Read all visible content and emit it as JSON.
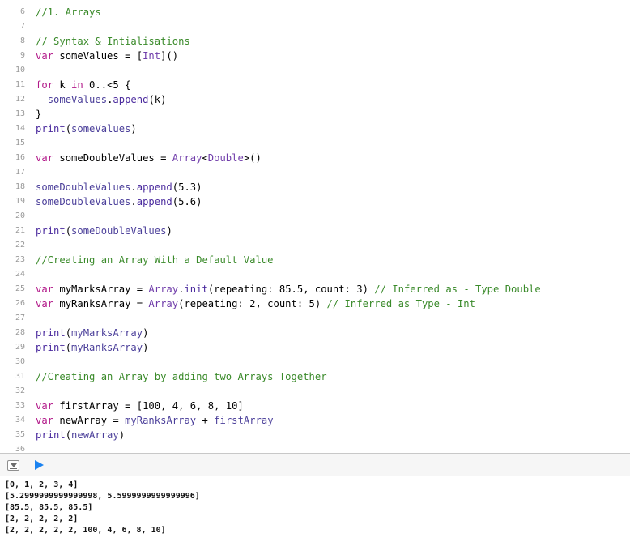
{
  "editor": {
    "lines": [
      {
        "num": "6",
        "tokens": [
          {
            "t": "//1. Arrays",
            "c": "cm"
          }
        ]
      },
      {
        "num": "7",
        "tokens": []
      },
      {
        "num": "8",
        "tokens": [
          {
            "t": "// Syntax & Intialisations",
            "c": "cm"
          }
        ]
      },
      {
        "num": "9",
        "tokens": [
          {
            "t": "var",
            "c": "kw"
          },
          {
            "t": " someValues = [",
            "c": "pl"
          },
          {
            "t": "Int",
            "c": "ty"
          },
          {
            "t": "]()",
            "c": "pl"
          }
        ]
      },
      {
        "num": "10",
        "tokens": []
      },
      {
        "num": "11",
        "tokens": [
          {
            "t": "for",
            "c": "kw"
          },
          {
            "t": " k ",
            "c": "pl"
          },
          {
            "t": "in",
            "c": "kw"
          },
          {
            "t": " 0..<5 {",
            "c": "pl"
          }
        ]
      },
      {
        "num": "12",
        "tokens": [
          {
            "t": "  ",
            "c": "pl"
          },
          {
            "t": "someValues",
            "c": "id"
          },
          {
            "t": ".",
            "c": "pl"
          },
          {
            "t": "append",
            "c": "fn"
          },
          {
            "t": "(k)",
            "c": "pl"
          }
        ]
      },
      {
        "num": "13",
        "tokens": [
          {
            "t": "}",
            "c": "pl"
          }
        ]
      },
      {
        "num": "14",
        "tokens": [
          {
            "t": "print",
            "c": "fn"
          },
          {
            "t": "(",
            "c": "pl"
          },
          {
            "t": "someValues",
            "c": "id"
          },
          {
            "t": ")",
            "c": "pl"
          }
        ]
      },
      {
        "num": "15",
        "tokens": []
      },
      {
        "num": "16",
        "tokens": [
          {
            "t": "var",
            "c": "kw"
          },
          {
            "t": " someDoubleValues = ",
            "c": "pl"
          },
          {
            "t": "Array",
            "c": "ty"
          },
          {
            "t": "<",
            "c": "pl"
          },
          {
            "t": "Double",
            "c": "ty"
          },
          {
            "t": ">()",
            "c": "pl"
          }
        ]
      },
      {
        "num": "17",
        "tokens": []
      },
      {
        "num": "18",
        "tokens": [
          {
            "t": "someDoubleValues",
            "c": "id"
          },
          {
            "t": ".",
            "c": "pl"
          },
          {
            "t": "append",
            "c": "fn"
          },
          {
            "t": "(5.3)",
            "c": "pl"
          }
        ]
      },
      {
        "num": "19",
        "tokens": [
          {
            "t": "someDoubleValues",
            "c": "id"
          },
          {
            "t": ".",
            "c": "pl"
          },
          {
            "t": "append",
            "c": "fn"
          },
          {
            "t": "(5.6)",
            "c": "pl"
          }
        ]
      },
      {
        "num": "20",
        "tokens": []
      },
      {
        "num": "21",
        "tokens": [
          {
            "t": "print",
            "c": "fn"
          },
          {
            "t": "(",
            "c": "pl"
          },
          {
            "t": "someDoubleValues",
            "c": "id"
          },
          {
            "t": ")",
            "c": "pl"
          }
        ]
      },
      {
        "num": "22",
        "tokens": []
      },
      {
        "num": "23",
        "tokens": [
          {
            "t": "//Creating an Array With a Default Value",
            "c": "cm"
          }
        ]
      },
      {
        "num": "24",
        "tokens": []
      },
      {
        "num": "25",
        "tokens": [
          {
            "t": "var",
            "c": "kw"
          },
          {
            "t": " myMarksArray = ",
            "c": "pl"
          },
          {
            "t": "Array",
            "c": "ty"
          },
          {
            "t": ".",
            "c": "pl"
          },
          {
            "t": "init",
            "c": "fn"
          },
          {
            "t": "(repeating: 85.5, count: 3) ",
            "c": "pl"
          },
          {
            "t": "// Inferred as - Type Double",
            "c": "cm"
          }
        ]
      },
      {
        "num": "26",
        "tokens": [
          {
            "t": "var",
            "c": "kw"
          },
          {
            "t": " myRanksArray = ",
            "c": "pl"
          },
          {
            "t": "Array",
            "c": "ty"
          },
          {
            "t": "(repeating: 2, count: 5) ",
            "c": "pl"
          },
          {
            "t": "// Inferred as Type - Int",
            "c": "cm"
          }
        ]
      },
      {
        "num": "27",
        "tokens": []
      },
      {
        "num": "28",
        "tokens": [
          {
            "t": "print",
            "c": "fn"
          },
          {
            "t": "(",
            "c": "pl"
          },
          {
            "t": "myMarksArray",
            "c": "id"
          },
          {
            "t": ")",
            "c": "pl"
          }
        ]
      },
      {
        "num": "29",
        "tokens": [
          {
            "t": "print",
            "c": "fn"
          },
          {
            "t": "(",
            "c": "pl"
          },
          {
            "t": "myRanksArray",
            "c": "id"
          },
          {
            "t": ")",
            "c": "pl"
          }
        ]
      },
      {
        "num": "30",
        "tokens": []
      },
      {
        "num": "31",
        "tokens": [
          {
            "t": "//Creating an Array by adding two Arrays Together",
            "c": "cm"
          }
        ]
      },
      {
        "num": "32",
        "tokens": []
      },
      {
        "num": "33",
        "tokens": [
          {
            "t": "var",
            "c": "kw"
          },
          {
            "t": " firstArray = [100, 4, 6, 8, 10]",
            "c": "pl"
          }
        ]
      },
      {
        "num": "34",
        "tokens": [
          {
            "t": "var",
            "c": "kw"
          },
          {
            "t": " newArray = ",
            "c": "pl"
          },
          {
            "t": "myRanksArray",
            "c": "id"
          },
          {
            "t": " + ",
            "c": "pl"
          },
          {
            "t": "firstArray",
            "c": "id"
          }
        ]
      },
      {
        "num": "35",
        "tokens": [
          {
            "t": "print",
            "c": "fn"
          },
          {
            "t": "(",
            "c": "pl"
          },
          {
            "t": "newArray",
            "c": "id"
          },
          {
            "t": ")",
            "c": "pl"
          }
        ]
      },
      {
        "num": "36",
        "tokens": []
      }
    ]
  },
  "debug_bar": {
    "toggle_icon": "hide-debug-area-icon",
    "run_icon": "run-play-icon",
    "run_color": "#1a82f0"
  },
  "console": {
    "output": [
      "[0, 1, 2, 3, 4]",
      "[5.2999999999999998, 5.5999999999999996]",
      "[85.5, 85.5, 85.5]",
      "[2, 2, 2, 2, 2]",
      "[2, 2, 2, 2, 2, 100, 4, 6, 8, 10]"
    ]
  },
  "colors": {
    "keyword": "#b21889",
    "comment": "#3a8a2a",
    "type": "#703daa",
    "function": "#4b2b9e",
    "identifier": "#4b3f9a",
    "line_number": "#9a9a9a"
  }
}
